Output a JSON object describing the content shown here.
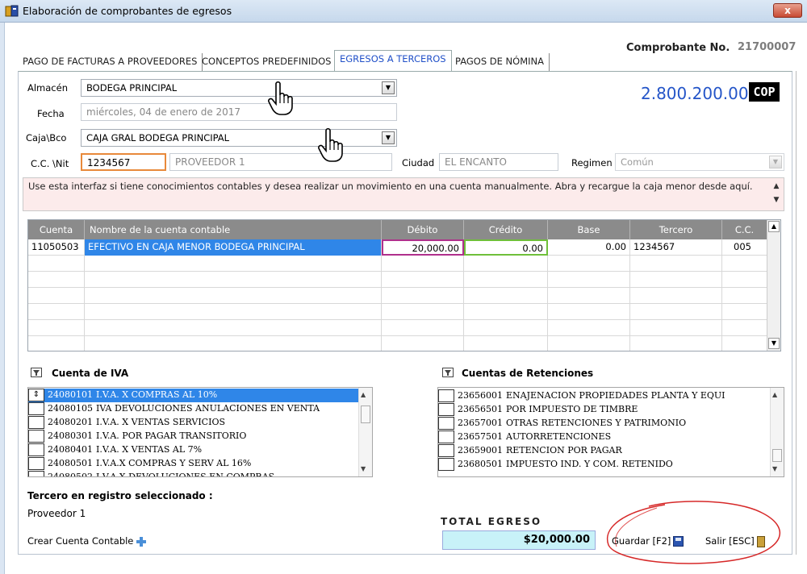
{
  "window": {
    "title": "Elaboración de comprobantes de egresos",
    "close_label": "x",
    "app_icon": "ledger-icon"
  },
  "comprobante": {
    "label": "Comprobante No.",
    "value": "21700007"
  },
  "tabs": [
    {
      "label": "PAGO DE FACTURAS A PROVEEDORES"
    },
    {
      "label": "CONCEPTOS PREDEFINIDOS"
    },
    {
      "label": "EGRESOS A TERCEROS"
    },
    {
      "label": "PAGOS DE NÓMINA"
    }
  ],
  "form": {
    "almacen_label": "Almacén",
    "almacen_value": "BODEGA PRINCIPAL",
    "fecha_label": "Fecha",
    "fecha_value": "miércoles, 04 de enero de 2017",
    "caja_label": "Caja\\Bco",
    "caja_value": "CAJA GRAL BODEGA PRINCIPAL",
    "ccnit_label": "C.C. \\Nit",
    "ccnit_value": "1234567",
    "proveedor_value": "PROVEEDOR 1",
    "ciudad_label": "Ciudad",
    "ciudad_value": "EL ENCANTO",
    "regimen_label": "Regimen",
    "regimen_value": "Común"
  },
  "total_amount": "2.800.200.00",
  "currency": "COP",
  "notice": "Use esta interfaz si tiene conocimientos contables y desea realizar un movimiento en una cuenta manualmente. Abra y recargue la caja menor desde aquí.",
  "grid": {
    "headers": [
      "Cuenta",
      "Nombre de la cuenta contable",
      "Débito",
      "Crédito",
      "Base",
      "Tercero",
      "C.C."
    ],
    "rows": [
      {
        "cuenta": "11050503",
        "nombre": "EFECTIVO EN CAJA MENOR BODEGA PRINCIPAL",
        "debito": "20,000.00",
        "credito": "0.00",
        "base": "0.00",
        "tercero": "1234567",
        "cc": "005"
      }
    ]
  },
  "iva": {
    "title": "Cuenta de IVA",
    "items": [
      {
        "code": "24080101",
        "name": "I.V.A. X COMPRAS AL 10%"
      },
      {
        "code": "24080105",
        "name": "IVA  DEVOLUCIONES ANULACIONES EN VENTA"
      },
      {
        "code": "24080201",
        "name": "I.V.A. X VENTAS SERVICIOS"
      },
      {
        "code": "24080301",
        "name": "I.V.A. POR PAGAR TRANSITORIO"
      },
      {
        "code": "24080401",
        "name": "I.V.A. X VENTAS AL 7%"
      },
      {
        "code": "24080501",
        "name": "I.V.A.X COMPRAS Y SERV AL 16%"
      },
      {
        "code": "24080502",
        "name": "I.V.A X DEVOLUCIONES EN COMPRAS"
      }
    ]
  },
  "retenciones": {
    "title": "Cuentas de Retenciones",
    "items": [
      {
        "code": "23656001",
        "name": "ENAJENACION PROPIEDADES PLANTA Y EQUI"
      },
      {
        "code": "23656501",
        "name": "POR IMPUESTO DE TIMBRE"
      },
      {
        "code": "23657001",
        "name": "OTRAS RETENCIONES Y PATRIMONIO"
      },
      {
        "code": "23657501",
        "name": "AUTORRETENCIONES"
      },
      {
        "code": "23659001",
        "name": "RETENCION POR PAGAR"
      },
      {
        "code": "23680501",
        "name": "IMPUESTO IND. Y COM. RETENIDO"
      }
    ]
  },
  "footer": {
    "tercero_label": "Tercero en registro seleccionado :",
    "tercero_value": "Proveedor 1",
    "crear_label": "Crear Cuenta Contable",
    "total_label": "TOTAL EGRESO",
    "total_value": "$20,000.00",
    "guardar_label": "Guardar [F2]",
    "salir_label": "Salir [ESC]"
  },
  "colors": {
    "accent": "#2455c8",
    "selection": "#2f86e8",
    "total_bg": "#c8f2f8",
    "header_bg": "#8b8b8b",
    "notice_bg": "#fcebeb"
  }
}
